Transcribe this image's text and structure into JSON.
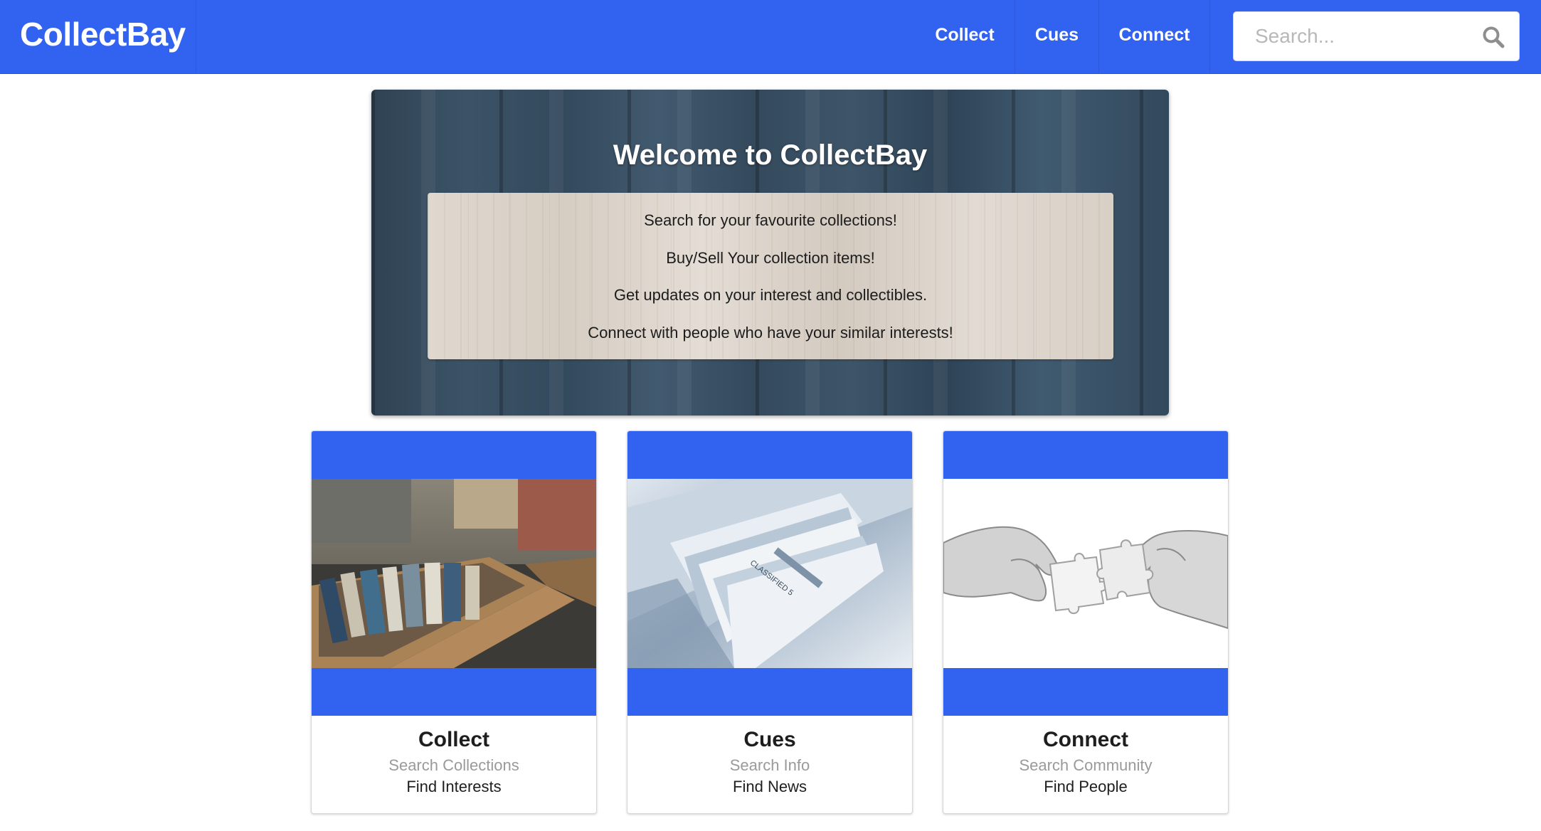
{
  "navbar": {
    "brand": "CollectBay",
    "items": [
      {
        "label": "Collect"
      },
      {
        "label": "Cues"
      },
      {
        "label": "Connect"
      }
    ],
    "search": {
      "placeholder": "Search...",
      "value": ""
    }
  },
  "hero": {
    "title": "Welcome to CollectBay",
    "lines": [
      "Search for your favourite collections!",
      "Buy/Sell Your collection items!",
      "Get updates on your interest and collectibles.",
      "Connect with people who have your similar interests!"
    ]
  },
  "cards": [
    {
      "title": "Collect",
      "subtitle": "Search Collections",
      "link": "Find Interests"
    },
    {
      "title": "Cues",
      "subtitle": "Search Info",
      "link": "Find News"
    },
    {
      "title": "Connect",
      "subtitle": "Search Community",
      "link": "Find People"
    }
  ],
  "colors": {
    "brand_blue": "#3162f0",
    "white": "#ffffff",
    "muted_text": "#9a9a9a"
  }
}
